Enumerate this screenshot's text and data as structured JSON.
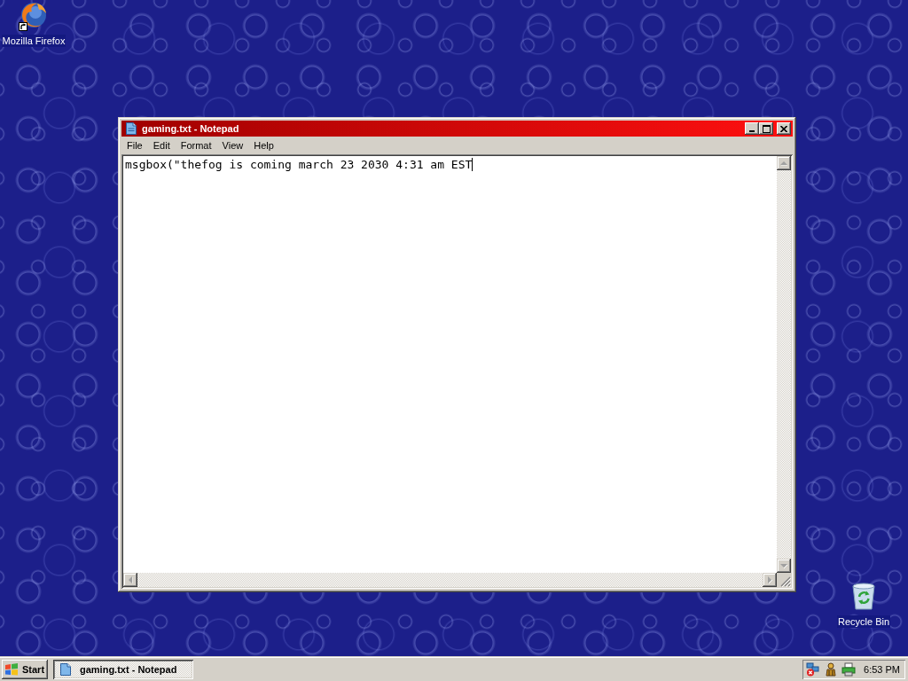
{
  "desktop": {
    "icons": [
      {
        "label": "Mozilla Firefox",
        "kind": "browser",
        "shortcut": true
      },
      {
        "label": "Recycle Bin",
        "kind": "recycle-bin",
        "shortcut": false
      }
    ]
  },
  "window": {
    "title": "gaming.txt - Notepad",
    "active": true,
    "menu": [
      "File",
      "Edit",
      "Format",
      "View",
      "Help"
    ],
    "text": "msgbox(\"thefog is coming march 23 2030 4:31 am EST"
  },
  "taskbar": {
    "start": "Start",
    "tasks": [
      {
        "label": "gaming.txt - Notepad",
        "selected": true
      }
    ],
    "clock": "6:53 PM"
  }
}
